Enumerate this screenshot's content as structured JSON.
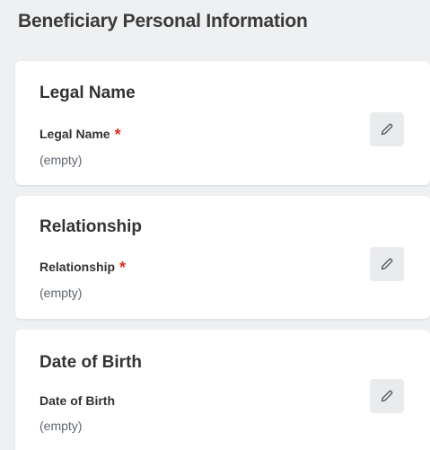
{
  "section": {
    "title": "Beneficiary Personal Information"
  },
  "cards": [
    {
      "title": "Legal Name",
      "field_label": "Legal Name",
      "required_mark": "*",
      "value": "(empty)",
      "edit_icon": "pencil-icon"
    },
    {
      "title": "Relationship",
      "field_label": "Relationship",
      "required_mark": "*",
      "value": "(empty)",
      "edit_icon": "pencil-icon"
    },
    {
      "title": "Date of Birth",
      "field_label": "Date of Birth",
      "value": "(empty)",
      "edit_icon": "pencil-icon"
    }
  ],
  "colors": {
    "background": "#eef0f2",
    "card": "#ffffff",
    "required": "#de2e21",
    "edit_button": "#e9ebed"
  }
}
